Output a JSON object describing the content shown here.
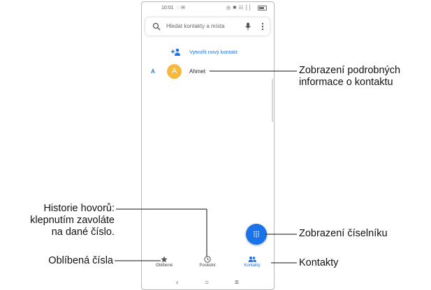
{
  "status_bar": {
    "time": "10:01",
    "notifications": "◌ ✉",
    "right_icons": "◎ ✱ ☷ ││"
  },
  "search": {
    "placeholder": "Hledat kontakty a místa"
  },
  "create_contact": {
    "label": "Vytvořit nový kontakt"
  },
  "contacts": [
    {
      "section_letter": "A",
      "avatar_letter": "A",
      "name": "Ahmet",
      "avatar_color": "#f6b93b"
    }
  ],
  "bottom_nav": {
    "items": [
      {
        "label": "Oblíbené",
        "icon": "star-icon",
        "active": false
      },
      {
        "label": "Poslední",
        "icon": "clock-icon",
        "active": false
      },
      {
        "label": "Kontakty",
        "icon": "people-icon",
        "active": true
      }
    ]
  },
  "system_nav": {
    "back": "‹",
    "home": "○",
    "recents": "≡"
  },
  "callouts": {
    "contact_details_line1": "Zobrazení podrobných",
    "contact_details_line2": "informace o kontaktu",
    "call_history_line1": "Historie hovorů:",
    "call_history_line2": "klepnutím zavoláte",
    "call_history_line3": "na dané číslo.",
    "dialpad": "Zobrazení číselníku",
    "favorites": "Oblíbená čísla",
    "contacts": "Kontakty"
  },
  "colors": {
    "accent": "#1a73e8",
    "avatar": "#f6b93b"
  }
}
